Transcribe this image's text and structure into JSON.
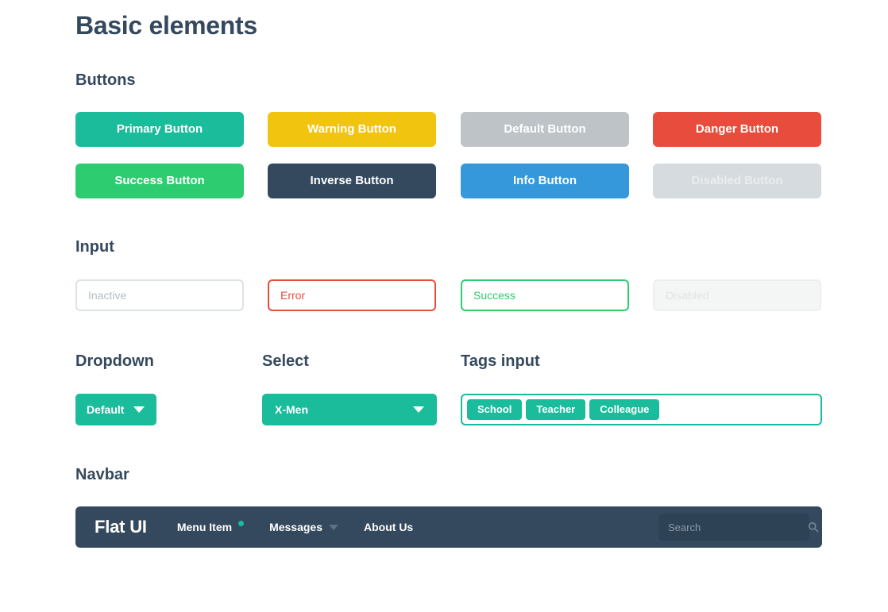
{
  "page": {
    "title": "Basic elements"
  },
  "sections": {
    "buttons": "Buttons",
    "input": "Input",
    "dropdown": "Dropdown",
    "select": "Select",
    "tags": "Tags input",
    "navbar": "Navbar"
  },
  "buttons": [
    {
      "label": "Primary Button",
      "style": "primary",
      "disabled": false
    },
    {
      "label": "Warning Button",
      "style": "warning",
      "disabled": false
    },
    {
      "label": "Default Button",
      "style": "default",
      "disabled": false
    },
    {
      "label": "Danger Button",
      "style": "danger",
      "disabled": false
    },
    {
      "label": "Success Button",
      "style": "success",
      "disabled": false
    },
    {
      "label": "Inverse Button",
      "style": "inverse",
      "disabled": false
    },
    {
      "label": "Info Button",
      "style": "info",
      "disabled": false
    },
    {
      "label": "Disabled Button",
      "style": "disabled",
      "disabled": true
    }
  ],
  "inputs": [
    {
      "placeholder": "Inactive",
      "value": "",
      "state": "inactive"
    },
    {
      "placeholder": "Error",
      "value": "",
      "state": "error"
    },
    {
      "placeholder": "Success",
      "value": "",
      "state": "success"
    },
    {
      "placeholder": "Disabled",
      "value": "",
      "state": "disabled"
    }
  ],
  "dropdown": {
    "selected": "Default",
    "caret_icon": "caret-down-icon"
  },
  "select": {
    "selected": "X-Men",
    "caret_icon": "caret-down-icon"
  },
  "tags": {
    "items": [
      "School",
      "Teacher",
      "Colleague"
    ],
    "placeholder": ""
  },
  "navbar": {
    "brand": "Flat UI",
    "items": [
      {
        "label": "Menu Item",
        "badge_dot": true,
        "caret": false
      },
      {
        "label": "Messages",
        "badge_dot": false,
        "caret": true
      },
      {
        "label": "About Us",
        "badge_dot": false,
        "caret": false
      }
    ],
    "search": {
      "placeholder": "Search",
      "value": "",
      "icon": "search-icon"
    }
  },
  "colors": {
    "primary": "#1abc9c",
    "warning": "#f1c40f",
    "default": "#bdc3c7",
    "danger": "#e74c3c",
    "success": "#2ecc71",
    "inverse": "#34495e",
    "info": "#3498db",
    "disabled": "#d6dbdf",
    "text": "#34495e",
    "background": "#ffffff"
  }
}
